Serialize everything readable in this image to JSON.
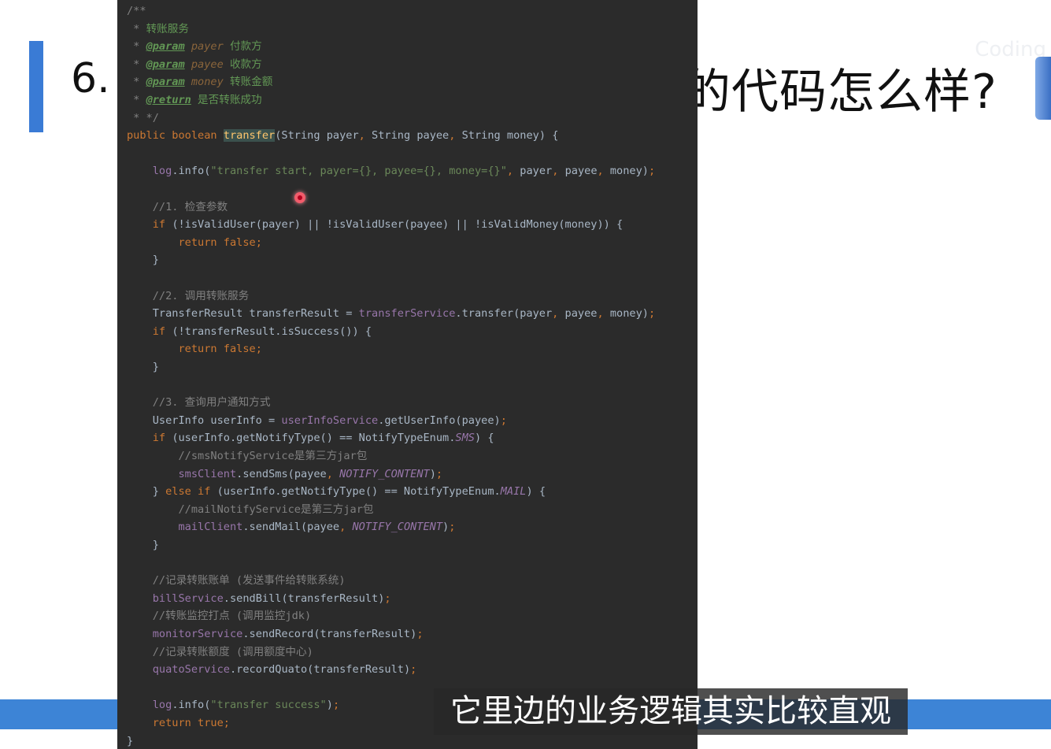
{
  "slide": {
    "number": "6.",
    "title_visible": "的代码怎么样?",
    "watermark": "Coding",
    "accent_color": "#3a7bd5"
  },
  "editor": {
    "theme": "darcula",
    "lines": [
      [
        [
          "c",
          "/**"
        ]
      ],
      [
        [
          "c",
          " * "
        ],
        [
          "d",
          "转账服务"
        ]
      ],
      [
        [
          "c",
          " * "
        ],
        [
          "dt",
          "@param"
        ],
        [
          "c",
          " "
        ],
        [
          "dp",
          "payer"
        ],
        [
          "d",
          " 付款方"
        ]
      ],
      [
        [
          "c",
          " * "
        ],
        [
          "dt",
          "@param"
        ],
        [
          "c",
          " "
        ],
        [
          "dp",
          "payee"
        ],
        [
          "d",
          " 收款方"
        ]
      ],
      [
        [
          "c",
          " * "
        ],
        [
          "dt",
          "@param"
        ],
        [
          "c",
          " "
        ],
        [
          "dp",
          "money"
        ],
        [
          "d",
          " 转账金额"
        ]
      ],
      [
        [
          "c",
          " * "
        ],
        [
          "dt",
          "@return"
        ],
        [
          "d",
          " 是否转账成功"
        ]
      ],
      [
        [
          "c",
          " * */"
        ]
      ],
      [
        [
          "k",
          "public boolean "
        ],
        [
          "hl",
          "transfer"
        ],
        [
          "p",
          "(String payer"
        ],
        [
          "k",
          ", "
        ],
        [
          "p",
          "String payee"
        ],
        [
          "k",
          ", "
        ],
        [
          "p",
          "String money) {"
        ]
      ],
      [],
      [
        [
          "p",
          "    "
        ],
        [
          "f",
          "log"
        ],
        [
          "p",
          ".info("
        ],
        [
          "s",
          "\"transfer start, payer={}, payee={}, money={}\""
        ],
        [
          "k",
          ", "
        ],
        [
          "p",
          "payer"
        ],
        [
          "k",
          ", "
        ],
        [
          "p",
          "payee"
        ],
        [
          "k",
          ", "
        ],
        [
          "p",
          "money)"
        ],
        [
          "k",
          ";"
        ]
      ],
      [],
      [
        [
          "c",
          "    //1. 检查参数"
        ]
      ],
      [
        [
          "p",
          "    "
        ],
        [
          "k",
          "if "
        ],
        [
          "p",
          "(!isValidUser(payer) || !isValidUser(payee) || !isValidMoney(money)) {"
        ]
      ],
      [
        [
          "p",
          "        "
        ],
        [
          "k",
          "return false;"
        ]
      ],
      [
        [
          "p",
          "    }"
        ]
      ],
      [],
      [
        [
          "c",
          "    //2. 调用转账服务"
        ]
      ],
      [
        [
          "p",
          "    TransferResult transferResult = "
        ],
        [
          "f",
          "transferService"
        ],
        [
          "p",
          ".transfer(payer"
        ],
        [
          "k",
          ", "
        ],
        [
          "p",
          "payee"
        ],
        [
          "k",
          ", "
        ],
        [
          "p",
          "money)"
        ],
        [
          "k",
          ";"
        ]
      ],
      [
        [
          "p",
          "    "
        ],
        [
          "k",
          "if "
        ],
        [
          "p",
          "(!transferResult.isSuccess()) {"
        ]
      ],
      [
        [
          "p",
          "        "
        ],
        [
          "k",
          "return false;"
        ]
      ],
      [
        [
          "p",
          "    }"
        ]
      ],
      [],
      [
        [
          "c",
          "    //3. 查询用户通知方式"
        ]
      ],
      [
        [
          "p",
          "    UserInfo userInfo = "
        ],
        [
          "f",
          "userInfoService"
        ],
        [
          "p",
          ".getUserInfo(payee)"
        ],
        [
          "k",
          ";"
        ]
      ],
      [
        [
          "p",
          "    "
        ],
        [
          "k",
          "if "
        ],
        [
          "p",
          "(userInfo.getNotifyType() == NotifyTypeEnum."
        ],
        [
          "cst",
          "SMS"
        ],
        [
          "p",
          ") {"
        ]
      ],
      [
        [
          "c",
          "        //smsNotifyService是第三方jar包"
        ]
      ],
      [
        [
          "p",
          "        "
        ],
        [
          "f",
          "smsClient"
        ],
        [
          "p",
          ".sendSms(payee"
        ],
        [
          "k",
          ", "
        ],
        [
          "cst",
          "NOTIFY_CONTENT"
        ],
        [
          "p",
          ")"
        ],
        [
          "k",
          ";"
        ]
      ],
      [
        [
          "p",
          "    } "
        ],
        [
          "k",
          "else if "
        ],
        [
          "p",
          "(userInfo.getNotifyType() == NotifyTypeEnum."
        ],
        [
          "cst",
          "MAIL"
        ],
        [
          "p",
          ") {"
        ]
      ],
      [
        [
          "c",
          "        //mailNotifyService是第三方jar包"
        ]
      ],
      [
        [
          "p",
          "        "
        ],
        [
          "f",
          "mailClient"
        ],
        [
          "p",
          ".sendMail(payee"
        ],
        [
          "k",
          ", "
        ],
        [
          "cst",
          "NOTIFY_CONTENT"
        ],
        [
          "p",
          ")"
        ],
        [
          "k",
          ";"
        ]
      ],
      [
        [
          "p",
          "    }"
        ]
      ],
      [],
      [
        [
          "c",
          "    //记录转账账单 (发送事件给转账系统)"
        ]
      ],
      [
        [
          "p",
          "    "
        ],
        [
          "f",
          "billService"
        ],
        [
          "p",
          ".sendBill(transferResult)"
        ],
        [
          "k",
          ";"
        ]
      ],
      [
        [
          "c",
          "    //转账监控打点 (调用监控jdk)"
        ]
      ],
      [
        [
          "p",
          "    "
        ],
        [
          "f",
          "monitorService"
        ],
        [
          "p",
          ".sendRecord(transferResult)"
        ],
        [
          "k",
          ";"
        ]
      ],
      [
        [
          "c",
          "    //记录转账额度 (调用额度中心)"
        ]
      ],
      [
        [
          "p",
          "    "
        ],
        [
          "f",
          "quatoService"
        ],
        [
          "p",
          ".recordQuato(transferResult)"
        ],
        [
          "k",
          ";"
        ]
      ],
      [],
      [
        [
          "p",
          "    "
        ],
        [
          "f",
          "log"
        ],
        [
          "p",
          ".info("
        ],
        [
          "s",
          "\"transfer success\""
        ],
        [
          "p",
          ")"
        ],
        [
          "k",
          ";"
        ]
      ],
      [
        [
          "p",
          "    "
        ],
        [
          "k",
          "return true;"
        ]
      ],
      [
        [
          "p",
          "}"
        ]
      ]
    ]
  },
  "subtitle": {
    "text": "它里边的业务逻辑其实比较直观"
  }
}
